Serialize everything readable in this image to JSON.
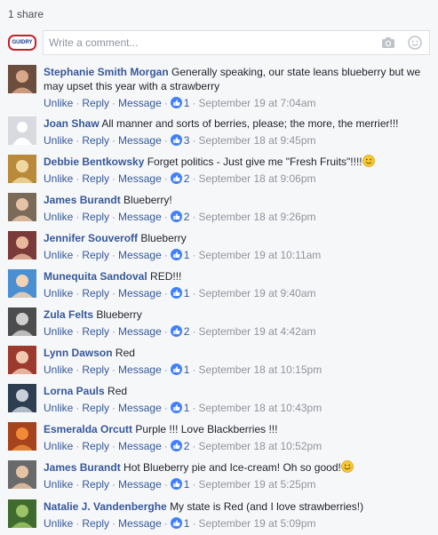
{
  "share_count": "1 share",
  "composer": {
    "placeholder": "Write a comment...",
    "logo_text": "GUIDRY"
  },
  "actions": {
    "unlike": "Unlike",
    "reply": "Reply",
    "message": "Message",
    "separator": "·"
  },
  "comments": [
    {
      "author": "Stephanie Smith Morgan",
      "text": "Generally speaking, our state leans blueberry but we may upset this year with a strawberry",
      "likes": "1",
      "time": "September 19 at 7:04am"
    },
    {
      "author": "Joan Shaw",
      "text": "All manner and sorts of berries, please; the more, the merrier!!!",
      "likes": "3",
      "time": "September 18 at 9:45pm"
    },
    {
      "author": "Debbie Bentkowsky",
      "text": "Forget politics - Just give me \"Fresh Fruits\"!!!!",
      "likes": "2",
      "time": "September 18 at 9:06pm",
      "emoji": "smile"
    },
    {
      "author": "James Burandt",
      "text": "Blueberry!",
      "likes": "2",
      "time": "September 18 at 9:26pm"
    },
    {
      "author": "Jennifer Souveroff",
      "text": "Blueberry",
      "likes": "1",
      "time": "September 19 at 10:11am"
    },
    {
      "author": "Munequita Sandoval",
      "text": "RED!!!",
      "likes": "1",
      "time": "September 19 at 9:40am"
    },
    {
      "author": "Zula Felts",
      "text": "Blueberry",
      "likes": "2",
      "time": "September 19 at 4:42am"
    },
    {
      "author": "Lynn Dawson",
      "text": "Red",
      "likes": "1",
      "time": "September 18 at 10:15pm"
    },
    {
      "author": "Lorna Pauls",
      "text": "Red",
      "likes": "1",
      "time": "September 18 at 10:43pm"
    },
    {
      "author": "Esmeralda Orcutt",
      "text": "Purple !!! Love Blackberries !!!",
      "likes": "2",
      "time": "September 18 at 10:52pm"
    },
    {
      "author": "James Burandt",
      "text": "Hot Blueberry pie and Ice-cream! Oh so good!",
      "likes": "1",
      "time": "September 19 at 5:25pm",
      "emoji": "blush"
    },
    {
      "author": "Natalie J. Vandenberghe",
      "text": "My state is Red (and I love strawberries!)",
      "likes": "1",
      "time": "September 19 at 5:09pm"
    }
  ],
  "colors": {
    "link": "#365899",
    "meta": "#90949c",
    "like": "#4080ff",
    "background": "#f6f7f9"
  },
  "icons": {
    "composer_left": "camera-icon",
    "composer_right": "emoji-icon",
    "like": "thumbs-up-icon"
  }
}
